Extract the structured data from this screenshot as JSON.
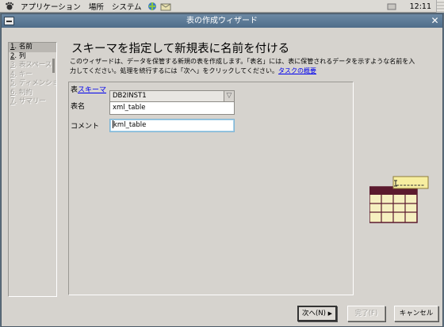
{
  "panel": {
    "menus": [
      "アプリケーション",
      "場所",
      "システム"
    ],
    "clock": "12:11"
  },
  "window": {
    "title": "表の作成ウィザード"
  },
  "steps": [
    {
      "num": "1",
      "label": "名前",
      "state": "active"
    },
    {
      "num": "2",
      "label": "列",
      "state": "enabled"
    },
    {
      "num": "3",
      "label": "表スペース",
      "state": "disabled"
    },
    {
      "num": "4",
      "label": "キー",
      "state": "disabled"
    },
    {
      "num": "5",
      "label": "ディメンション",
      "state": "disabled"
    },
    {
      "num": "6",
      "label": "制約",
      "state": "disabled"
    },
    {
      "num": "7",
      "label": "サマリー",
      "state": "disabled"
    }
  ],
  "main": {
    "heading": "スキーマを指定して新規表に名前を付ける",
    "desc_line1": "このウィザードは、データを保管する新規の表を作成します。「表名」には、表に保管されるデータを示すような名前を入",
    "desc_line2": "力してください。処理を続行するには「次へ」をクリックしてください。",
    "desc_link": "タスクの概要"
  },
  "form": {
    "schema_label_prefix": "表",
    "schema_label_link": "スキーマ",
    "schema_value": "DB2INST1",
    "table_name_label": "表名",
    "table_name_value": "xml_table",
    "comment_label": "コメント",
    "comment_value": "kml_table"
  },
  "buttons": {
    "next": "次へ(N)",
    "finish": "完了(F)",
    "cancel": "キャンセル"
  },
  "colors": {
    "title_bar": "#4f6d8a",
    "link": "#0000ee",
    "table_header": "#5b1a2e",
    "table_cell": "#f6f0c0"
  }
}
